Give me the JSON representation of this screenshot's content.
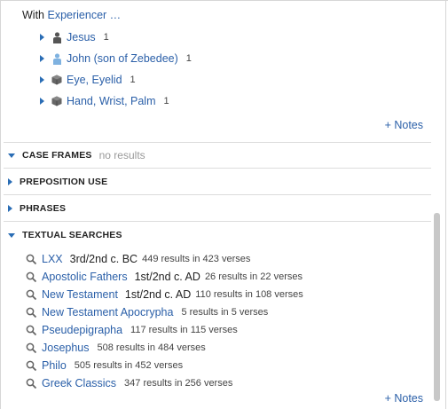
{
  "with_prefix": "With",
  "with_link": "Experiencer …",
  "experiencers": [
    {
      "label": "Jesus",
      "count": "1",
      "icon": "person-icon"
    },
    {
      "label": "John (son of Zebedee)",
      "count": "1",
      "icon": "person-icon"
    },
    {
      "label": "Eye, Eyelid",
      "count": "1",
      "icon": "cube-icon"
    },
    {
      "label": "Hand, Wrist, Palm",
      "count": "1",
      "icon": "cube-icon"
    }
  ],
  "notes_label": "+ Notes",
  "sections": {
    "case_frames": {
      "title": "CASE FRAMES",
      "status": "no results"
    },
    "preposition_use": {
      "title": "PREPOSITION USE"
    },
    "phrases": {
      "title": "PHRASES"
    },
    "textual_searches": {
      "title": "TEXTUAL SEARCHES"
    }
  },
  "searches": [
    {
      "label": "LXX",
      "date": "3rd/2nd c. BC",
      "count": "449 results in 423 verses"
    },
    {
      "label": "Apostolic Fathers",
      "date": "1st/2nd c. AD",
      "count": "26 results in 22 verses"
    },
    {
      "label": "New Testament",
      "date": "1st/2nd c. AD",
      "count": "110 results in 108 verses"
    },
    {
      "label": "New Testament Apocrypha",
      "date": "",
      "count": "5 results in 5 verses"
    },
    {
      "label": "Pseudepigrapha",
      "date": "",
      "count": "117 results in 115 verses"
    },
    {
      "label": "Josephus",
      "date": "",
      "count": "508 results in 484 verses"
    },
    {
      "label": "Philo",
      "date": "",
      "count": "505 results in 452 verses"
    },
    {
      "label": "Greek Classics",
      "date": "",
      "count": "347 results in 256 verses"
    }
  ],
  "colors": {
    "link": "#2a5fa8",
    "triangle": "#2a6db5",
    "icon_dark": "#555555",
    "icon_light": "#7fb2e0"
  }
}
